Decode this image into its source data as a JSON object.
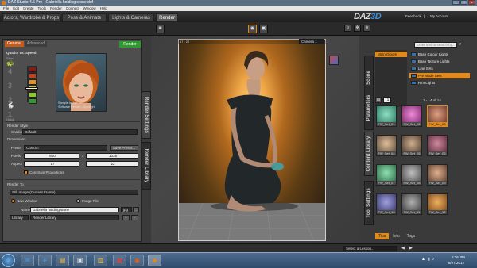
{
  "window": {
    "title": "DAZ Studio 4.5 Pro - Gabriella holding stone.duf",
    "min": "_",
    "max": "□",
    "close": "x"
  },
  "menu": [
    "File",
    "Edit",
    "Create",
    "Tools",
    "Render",
    "Connect",
    "Window",
    "Help"
  ],
  "tabs": [
    "Actors, Wardrobe & Props",
    "Pose & Animate",
    "Lights & Cameras",
    "Render"
  ],
  "active_tab": "Render",
  "brand": {
    "daz": "DAZ",
    "three_d": "3D",
    "feedback": "Feedback",
    "account": "My Account",
    "separator": "|"
  },
  "render_settings": {
    "subtabs": [
      "General",
      "Advanced"
    ],
    "render_button": "Render",
    "quality_label": "Quality vs. Speed",
    "slow": "Slow",
    "quick": "Quick",
    "levels": [
      "4",
      "3",
      "2",
      "1"
    ],
    "sample_caption_1": "Sample Image",
    "sample_caption_2": "Software Render - Spotlight",
    "render_style_label": "Render Style",
    "shader_label": "Shader",
    "shader_value": "Default",
    "dimensions_label": "Dimensions",
    "preset_label": "Preset",
    "preset_value": "Custom",
    "save_preset": "Save Preset...",
    "pixels_label": "Pixels",
    "pixels_w": "800",
    "pixels_sep": "x",
    "pixels_h": "1035",
    "aspect_label": "Aspect",
    "aspect_w": "17",
    "aspect_sep": ":",
    "aspect_h": "22",
    "constrain_label": "Constrain Proportions",
    "render_to_label": "Render To",
    "render_to_value": "Still Image (Current Frame)",
    "new_window_label": "New Window",
    "image_file_label": "Image File",
    "name_label": "Name",
    "name_value": "Gabriella holding stone",
    "format_value": "jpg",
    "browse": "...",
    "library_label": "Library",
    "library_value": "Render Library",
    "add": "+",
    "remove": "-"
  },
  "side_tabs_left": [
    "Render Settings",
    "Render Library"
  ],
  "viewport": {
    "frame_label": "17 : 22",
    "camera_label": "Camera 1"
  },
  "scene": {
    "search_placeholder": "Enter text to search by...",
    "root_item": "Main Gloom",
    "items": [
      "Base Colour Lights",
      "Base Texture Lights",
      "Line Sets",
      "Pre Made Sets",
      "Rim Lights"
    ],
    "selected_item": "Pre Made Sets",
    "page_label": "1",
    "count_label": "1 - 14 of 14"
  },
  "thumbnails": [
    "FW_Set_01",
    "FW_Set_02",
    "FW_Set_03",
    "FW_Set_04",
    "FW_Set_05",
    "FW_Set_06",
    "FW_Set_07",
    "FW_Set_08",
    "FW_Set_09",
    "FW_Set_10",
    "FW_Set_11",
    "FW_Set_12"
  ],
  "selected_thumbnail": "FW_Set_03",
  "side_tabs_right": [
    "Scene",
    "Parameters",
    "Content Library",
    "Tool Settings"
  ],
  "bottom_tabs": [
    "Tips",
    "Info",
    "Tags"
  ],
  "status": {
    "lesson": "Select a Lesson..."
  },
  "taskbar": {
    "time": "6:26 PM",
    "date": "8/27/2012"
  },
  "colors": {
    "accent": "#e08a1e",
    "render_green": "#2f9a2f",
    "brand_blue": "#3b8fd6"
  }
}
